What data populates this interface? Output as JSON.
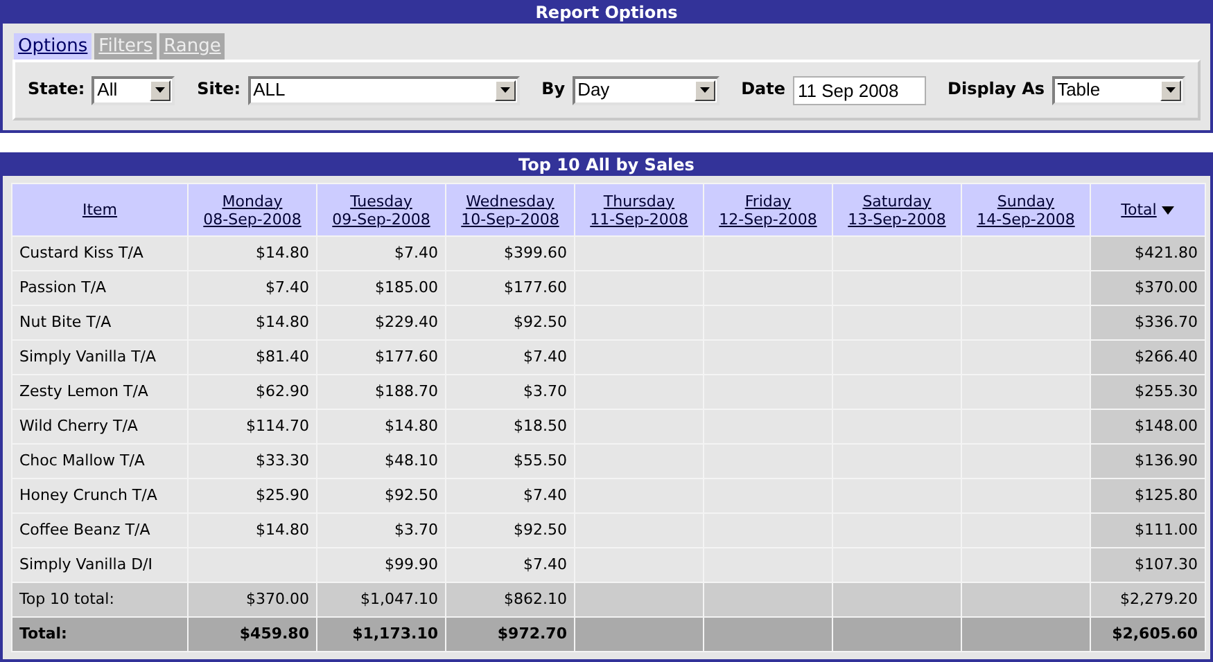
{
  "options_panel": {
    "title": "Report Options",
    "tabs": [
      {
        "label": "Options",
        "selected": true
      },
      {
        "label": "Filters",
        "selected": false
      },
      {
        "label": "Range",
        "selected": false
      }
    ],
    "fields": [
      {
        "kind": "select",
        "label": "State:",
        "value": "All"
      },
      {
        "kind": "select",
        "label": "Site:",
        "value": "ALL"
      },
      {
        "kind": "select",
        "label": "By",
        "value": "Day"
      },
      {
        "kind": "text",
        "label": "Date",
        "value": "11 Sep 2008"
      },
      {
        "kind": "select",
        "label": "Display As",
        "value": "Table"
      }
    ]
  },
  "report": {
    "title": "Top 10 All by Sales",
    "item_column": "Item",
    "day_columns": [
      {
        "day": "Monday",
        "date": "08-Sep-2008"
      },
      {
        "day": "Tuesday",
        "date": "09-Sep-2008"
      },
      {
        "day": "Wednesday",
        "date": "10-Sep-2008"
      },
      {
        "day": "Thursday",
        "date": "11-Sep-2008"
      },
      {
        "day": "Friday",
        "date": "12-Sep-2008"
      },
      {
        "day": "Saturday",
        "date": "13-Sep-2008"
      },
      {
        "day": "Sunday",
        "date": "14-Sep-2008"
      }
    ],
    "total_column": {
      "label": "Total",
      "sorted_descending": true
    },
    "rows": [
      {
        "kind": "item",
        "item": "Custard Kiss T/A",
        "cells": [
          {
            "kind": "amount",
            "text": "$14.80"
          },
          {
            "kind": "amount",
            "text": "$7.40"
          },
          {
            "kind": "amount",
            "text": "$399.60"
          },
          {
            "kind": "blank"
          },
          {
            "kind": "blank"
          },
          {
            "kind": "blank"
          },
          {
            "kind": "blank"
          }
        ],
        "total": "$421.80"
      },
      {
        "kind": "item",
        "item": "Passion T/A",
        "cells": [
          {
            "kind": "amount",
            "text": "$7.40"
          },
          {
            "kind": "amount",
            "text": "$185.00"
          },
          {
            "kind": "amount",
            "text": "$177.60"
          },
          {
            "kind": "blank"
          },
          {
            "kind": "blank"
          },
          {
            "kind": "blank"
          },
          {
            "kind": "blank"
          }
        ],
        "total": "$370.00"
      },
      {
        "kind": "item",
        "item": "Nut Bite T/A",
        "cells": [
          {
            "kind": "amount",
            "text": "$14.80"
          },
          {
            "kind": "amount",
            "text": "$229.40"
          },
          {
            "kind": "amount",
            "text": "$92.50"
          },
          {
            "kind": "blank"
          },
          {
            "kind": "blank"
          },
          {
            "kind": "blank"
          },
          {
            "kind": "blank"
          }
        ],
        "total": "$336.70"
      },
      {
        "kind": "item",
        "item": "Simply Vanilla T/A",
        "cells": [
          {
            "kind": "amount",
            "text": "$81.40"
          },
          {
            "kind": "amount",
            "text": "$177.60"
          },
          {
            "kind": "amount",
            "text": "$7.40"
          },
          {
            "kind": "blank"
          },
          {
            "kind": "blank"
          },
          {
            "kind": "blank"
          },
          {
            "kind": "blank"
          }
        ],
        "total": "$266.40"
      },
      {
        "kind": "item",
        "item": "Zesty Lemon T/A",
        "cells": [
          {
            "kind": "amount",
            "text": "$62.90"
          },
          {
            "kind": "amount",
            "text": "$188.70"
          },
          {
            "kind": "amount",
            "text": "$3.70"
          },
          {
            "kind": "blank"
          },
          {
            "kind": "blank"
          },
          {
            "kind": "blank"
          },
          {
            "kind": "blank"
          }
        ],
        "total": "$255.30"
      },
      {
        "kind": "item",
        "item": "Wild Cherry T/A",
        "cells": [
          {
            "kind": "amount",
            "text": "$114.70"
          },
          {
            "kind": "amount",
            "text": "$14.80"
          },
          {
            "kind": "amount",
            "text": "$18.50"
          },
          {
            "kind": "blank"
          },
          {
            "kind": "blank"
          },
          {
            "kind": "blank"
          },
          {
            "kind": "blank"
          }
        ],
        "total": "$148.00"
      },
      {
        "kind": "item",
        "item": "Choc Mallow T/A",
        "cells": [
          {
            "kind": "amount",
            "text": "$33.30"
          },
          {
            "kind": "amount",
            "text": "$48.10"
          },
          {
            "kind": "amount",
            "text": "$55.50"
          },
          {
            "kind": "blank"
          },
          {
            "kind": "blank"
          },
          {
            "kind": "blank"
          },
          {
            "kind": "blank"
          }
        ],
        "total": "$136.90"
      },
      {
        "kind": "item",
        "item": "Honey Crunch T/A",
        "cells": [
          {
            "kind": "amount",
            "text": "$25.90"
          },
          {
            "kind": "amount",
            "text": "$92.50"
          },
          {
            "kind": "amount",
            "text": "$7.40"
          },
          {
            "kind": "blank"
          },
          {
            "kind": "blank"
          },
          {
            "kind": "blank"
          },
          {
            "kind": "blank"
          }
        ],
        "total": "$125.80"
      },
      {
        "kind": "item",
        "item": "Coffee Beanz T/A",
        "cells": [
          {
            "kind": "amount",
            "text": "$14.80"
          },
          {
            "kind": "amount",
            "text": "$3.70"
          },
          {
            "kind": "amount",
            "text": "$92.50"
          },
          {
            "kind": "blank"
          },
          {
            "kind": "blank"
          },
          {
            "kind": "blank"
          },
          {
            "kind": "blank"
          }
        ],
        "total": "$111.00"
      },
      {
        "kind": "item",
        "item": "Simply Vanilla D/I",
        "cells": [
          {
            "kind": "blank"
          },
          {
            "kind": "amount",
            "text": "$99.90"
          },
          {
            "kind": "amount",
            "text": "$7.40"
          },
          {
            "kind": "blank"
          },
          {
            "kind": "blank"
          },
          {
            "kind": "blank"
          },
          {
            "kind": "blank"
          }
        ],
        "total": "$107.30"
      },
      {
        "kind": "subtotal",
        "item": "Top 10 total:",
        "cells": [
          {
            "kind": "amount",
            "text": "$370.00"
          },
          {
            "kind": "amount",
            "text": "$1,047.10"
          },
          {
            "kind": "amount",
            "text": "$862.10"
          },
          {
            "kind": "blank"
          },
          {
            "kind": "blank"
          },
          {
            "kind": "blank"
          },
          {
            "kind": "blank"
          }
        ],
        "total": "$2,279.20"
      },
      {
        "kind": "grand_total",
        "item": "Total:",
        "cells": [
          {
            "kind": "amount",
            "text": "$459.80"
          },
          {
            "kind": "amount",
            "text": "$1,173.10"
          },
          {
            "kind": "amount",
            "text": "$972.70"
          },
          {
            "kind": "blank"
          },
          {
            "kind": "blank"
          },
          {
            "kind": "blank"
          },
          {
            "kind": "blank"
          }
        ],
        "total": "$2,605.60"
      }
    ]
  }
}
